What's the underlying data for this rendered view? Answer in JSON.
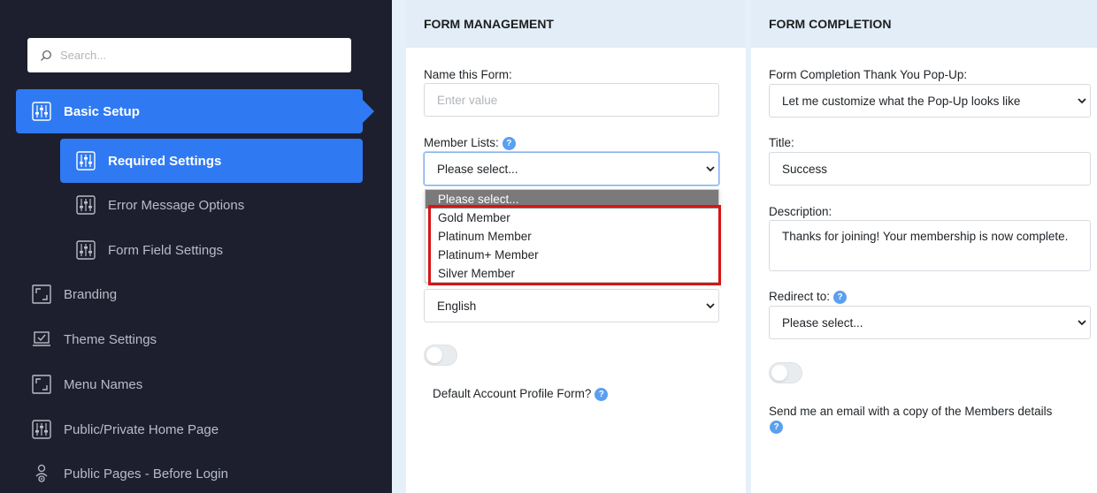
{
  "sidebar": {
    "search_placeholder": "Search...",
    "items": [
      {
        "label": "Basic Setup"
      },
      {
        "label": "Required Settings"
      },
      {
        "label": "Error Message Options"
      },
      {
        "label": "Form Field Settings"
      },
      {
        "label": "Branding"
      },
      {
        "label": "Theme Settings"
      },
      {
        "label": "Menu Names"
      },
      {
        "label": "Public/Private Home Page"
      },
      {
        "label": "Public Pages - Before Login"
      }
    ]
  },
  "form_management": {
    "header": "FORM MANAGEMENT",
    "name_label": "Name this Form:",
    "name_placeholder": "Enter value",
    "member_lists_label": "Member Lists:",
    "member_lists_value": "Please select...",
    "member_options": [
      "Please select...",
      "Gold Member",
      "Platinum Member",
      "Platinum+ Member",
      "Silver Member"
    ],
    "language_value": "English",
    "default_profile_label": "Default Account Profile Form?"
  },
  "form_completion": {
    "header": "FORM COMPLETION",
    "popup_label": "Form Completion Thank You Pop-Up:",
    "popup_value": "Let me customize what the Pop-Up looks like",
    "title_label": "Title:",
    "title_value": "Success",
    "description_label": "Description:",
    "description_value": "Thanks for joining! Your membership is now complete.",
    "redirect_label": "Redirect to:",
    "redirect_value": "Please select...",
    "email_copy_label": "Send me an email with a copy of the Members details"
  },
  "help_glyph": "?",
  "colors": {
    "sidebar_bg": "#1d1f2e",
    "accent": "#2f7af3",
    "highlight": "#d91414"
  }
}
